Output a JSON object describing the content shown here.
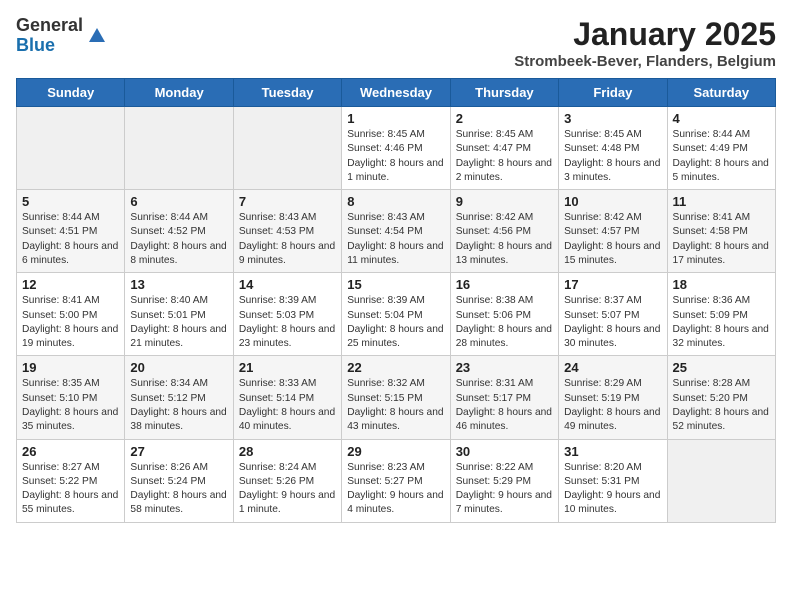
{
  "logo": {
    "general": "General",
    "blue": "Blue"
  },
  "title": "January 2025",
  "subtitle": "Strombeek-Bever, Flanders, Belgium",
  "days_header": [
    "Sunday",
    "Monday",
    "Tuesday",
    "Wednesday",
    "Thursday",
    "Friday",
    "Saturday"
  ],
  "weeks": [
    [
      {
        "day": "",
        "info": ""
      },
      {
        "day": "",
        "info": ""
      },
      {
        "day": "",
        "info": ""
      },
      {
        "day": "1",
        "info": "Sunrise: 8:45 AM\nSunset: 4:46 PM\nDaylight: 8 hours and 1 minute."
      },
      {
        "day": "2",
        "info": "Sunrise: 8:45 AM\nSunset: 4:47 PM\nDaylight: 8 hours and 2 minutes."
      },
      {
        "day": "3",
        "info": "Sunrise: 8:45 AM\nSunset: 4:48 PM\nDaylight: 8 hours and 3 minutes."
      },
      {
        "day": "4",
        "info": "Sunrise: 8:44 AM\nSunset: 4:49 PM\nDaylight: 8 hours and 5 minutes."
      }
    ],
    [
      {
        "day": "5",
        "info": "Sunrise: 8:44 AM\nSunset: 4:51 PM\nDaylight: 8 hours and 6 minutes."
      },
      {
        "day": "6",
        "info": "Sunrise: 8:44 AM\nSunset: 4:52 PM\nDaylight: 8 hours and 8 minutes."
      },
      {
        "day": "7",
        "info": "Sunrise: 8:43 AM\nSunset: 4:53 PM\nDaylight: 8 hours and 9 minutes."
      },
      {
        "day": "8",
        "info": "Sunrise: 8:43 AM\nSunset: 4:54 PM\nDaylight: 8 hours and 11 minutes."
      },
      {
        "day": "9",
        "info": "Sunrise: 8:42 AM\nSunset: 4:56 PM\nDaylight: 8 hours and 13 minutes."
      },
      {
        "day": "10",
        "info": "Sunrise: 8:42 AM\nSunset: 4:57 PM\nDaylight: 8 hours and 15 minutes."
      },
      {
        "day": "11",
        "info": "Sunrise: 8:41 AM\nSunset: 4:58 PM\nDaylight: 8 hours and 17 minutes."
      }
    ],
    [
      {
        "day": "12",
        "info": "Sunrise: 8:41 AM\nSunset: 5:00 PM\nDaylight: 8 hours and 19 minutes."
      },
      {
        "day": "13",
        "info": "Sunrise: 8:40 AM\nSunset: 5:01 PM\nDaylight: 8 hours and 21 minutes."
      },
      {
        "day": "14",
        "info": "Sunrise: 8:39 AM\nSunset: 5:03 PM\nDaylight: 8 hours and 23 minutes."
      },
      {
        "day": "15",
        "info": "Sunrise: 8:39 AM\nSunset: 5:04 PM\nDaylight: 8 hours and 25 minutes."
      },
      {
        "day": "16",
        "info": "Sunrise: 8:38 AM\nSunset: 5:06 PM\nDaylight: 8 hours and 28 minutes."
      },
      {
        "day": "17",
        "info": "Sunrise: 8:37 AM\nSunset: 5:07 PM\nDaylight: 8 hours and 30 minutes."
      },
      {
        "day": "18",
        "info": "Sunrise: 8:36 AM\nSunset: 5:09 PM\nDaylight: 8 hours and 32 minutes."
      }
    ],
    [
      {
        "day": "19",
        "info": "Sunrise: 8:35 AM\nSunset: 5:10 PM\nDaylight: 8 hours and 35 minutes."
      },
      {
        "day": "20",
        "info": "Sunrise: 8:34 AM\nSunset: 5:12 PM\nDaylight: 8 hours and 38 minutes."
      },
      {
        "day": "21",
        "info": "Sunrise: 8:33 AM\nSunset: 5:14 PM\nDaylight: 8 hours and 40 minutes."
      },
      {
        "day": "22",
        "info": "Sunrise: 8:32 AM\nSunset: 5:15 PM\nDaylight: 8 hours and 43 minutes."
      },
      {
        "day": "23",
        "info": "Sunrise: 8:31 AM\nSunset: 5:17 PM\nDaylight: 8 hours and 46 minutes."
      },
      {
        "day": "24",
        "info": "Sunrise: 8:29 AM\nSunset: 5:19 PM\nDaylight: 8 hours and 49 minutes."
      },
      {
        "day": "25",
        "info": "Sunrise: 8:28 AM\nSunset: 5:20 PM\nDaylight: 8 hours and 52 minutes."
      }
    ],
    [
      {
        "day": "26",
        "info": "Sunrise: 8:27 AM\nSunset: 5:22 PM\nDaylight: 8 hours and 55 minutes."
      },
      {
        "day": "27",
        "info": "Sunrise: 8:26 AM\nSunset: 5:24 PM\nDaylight: 8 hours and 58 minutes."
      },
      {
        "day": "28",
        "info": "Sunrise: 8:24 AM\nSunset: 5:26 PM\nDaylight: 9 hours and 1 minute."
      },
      {
        "day": "29",
        "info": "Sunrise: 8:23 AM\nSunset: 5:27 PM\nDaylight: 9 hours and 4 minutes."
      },
      {
        "day": "30",
        "info": "Sunrise: 8:22 AM\nSunset: 5:29 PM\nDaylight: 9 hours and 7 minutes."
      },
      {
        "day": "31",
        "info": "Sunrise: 8:20 AM\nSunset: 5:31 PM\nDaylight: 9 hours and 10 minutes."
      },
      {
        "day": "",
        "info": ""
      }
    ]
  ]
}
